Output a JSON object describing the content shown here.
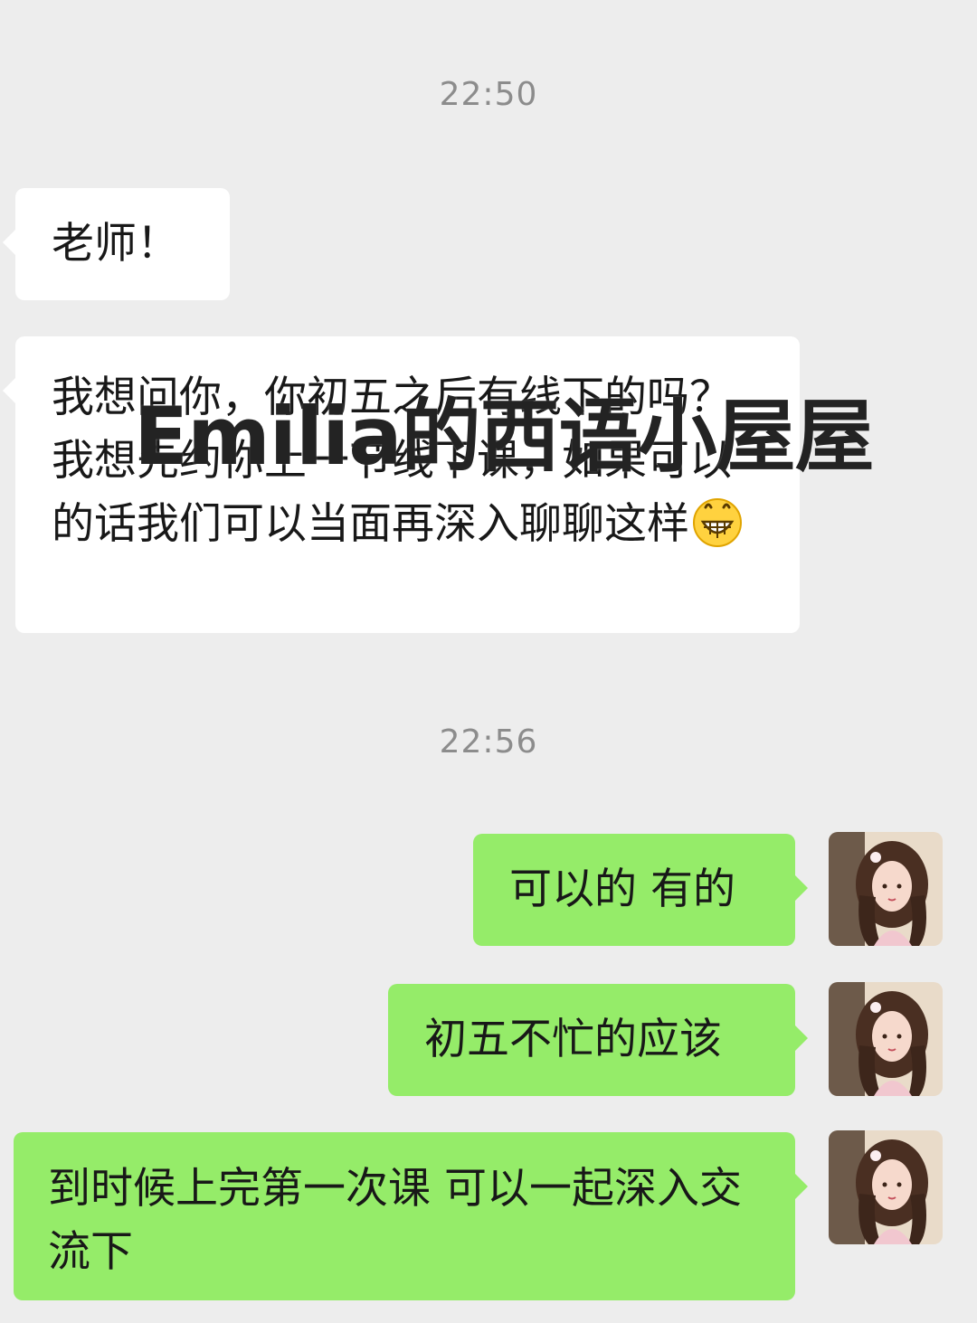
{
  "chat": {
    "timestamps": [
      "22:50",
      "22:56"
    ],
    "incoming": [
      {
        "text": "老师！"
      },
      {
        "text": "我想问你，你初五之后有线下的吗？我想先约你上一节线下课，如果可以的话我们可以当面再深入聊聊这样",
        "emoji": "grin-emoji"
      }
    ],
    "outgoing": [
      {
        "text": "可以的 有的"
      },
      {
        "text": "初五不忙的应该"
      },
      {
        "text": "到时候上完第一次课 可以一起深入交流下"
      }
    ]
  },
  "watermark": {
    "text": "Emilia的西语小屋屋"
  },
  "colors": {
    "background": "#ededed",
    "incoming_bubble": "#ffffff",
    "outgoing_bubble": "#95ec69",
    "timestamp": "#8c8c8c"
  },
  "icons": {
    "avatar": "user-avatar-portrait",
    "emoji": "grin-emoji"
  }
}
